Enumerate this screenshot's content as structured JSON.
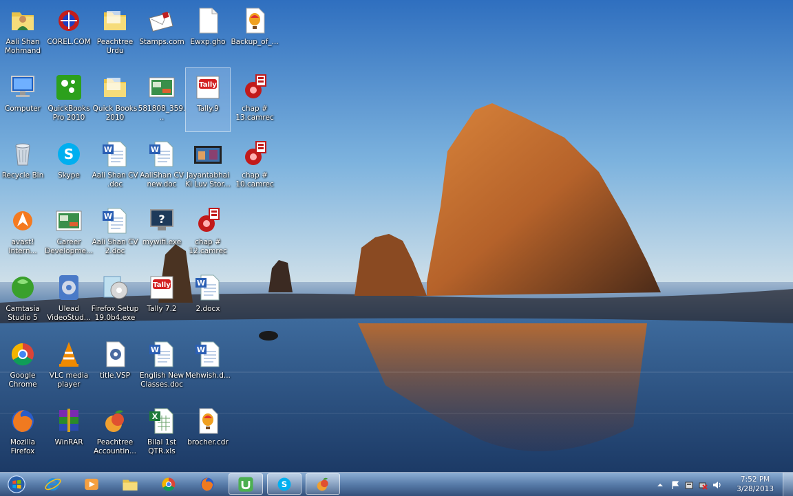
{
  "desktop": {
    "icons": [
      {
        "label": "Aali Shan Mohmand",
        "icon": "folder-user-icon"
      },
      {
        "label": "COREL.COM",
        "icon": "corel-icon"
      },
      {
        "label": "Peachtree Urdu",
        "icon": "folder-icon"
      },
      {
        "label": "Stamps.com",
        "icon": "envelope-icon"
      },
      {
        "label": "Ewxp.gho",
        "icon": "blank-file-icon"
      },
      {
        "label": "Backup_of_...",
        "icon": "balloon-file-icon"
      },
      {
        "label": "Computer",
        "icon": "computer-icon"
      },
      {
        "label": "QuickBooks Pro 2010",
        "icon": "quickbooks-icon"
      },
      {
        "label": "Quick Books 2010",
        "icon": "folder-icon"
      },
      {
        "label": "581808_359...",
        "icon": "image-file-icon"
      },
      {
        "label": "Tally.9",
        "icon": "tally-icon"
      },
      {
        "label": "chap # 13.camrec",
        "icon": "camrec-icon"
      },
      {
        "label": "Recycle Bin",
        "icon": "recycle-bin-icon"
      },
      {
        "label": "Skype",
        "icon": "skype-icon"
      },
      {
        "label": "Aali Shan CV .doc",
        "icon": "word-doc-icon"
      },
      {
        "label": "AaliShan CV new.doc",
        "icon": "word-doc-icon"
      },
      {
        "label": "Jayantabhai Ki Luv Stor...",
        "icon": "video-file-icon"
      },
      {
        "label": "chap # 10.camrec",
        "icon": "camrec-icon"
      },
      {
        "label": "avast! Intern...",
        "icon": "avast-icon"
      },
      {
        "label": "Career Developme...",
        "icon": "image-file-icon"
      },
      {
        "label": "Aali Shan CV 2.doc",
        "icon": "word-doc-icon"
      },
      {
        "label": "mywifi.exe",
        "icon": "help-monitor-icon"
      },
      {
        "label": "chap # 12.camrec",
        "icon": "camrec-icon"
      },
      {
        "label": "Camtasia Studio 5",
        "icon": "camtasia-icon"
      },
      {
        "label": "Ulead VideoStud...",
        "icon": "ulead-icon"
      },
      {
        "label": "Firefox Setup 19.0b4.exe",
        "icon": "installer-icon"
      },
      {
        "label": "Tally 7.2",
        "icon": "tally-icon"
      },
      {
        "label": "2.docx",
        "icon": "word-doc-icon"
      },
      {
        "label": "Google Chrome",
        "icon": "chrome-icon"
      },
      {
        "label": "VLC media player",
        "icon": "vlc-icon"
      },
      {
        "label": "title.VSP",
        "icon": "vsp-file-icon"
      },
      {
        "label": "English New Classes.doc",
        "icon": "word-doc-icon"
      },
      {
        "label": "Mehwish.d...",
        "icon": "word-doc-icon"
      },
      {
        "label": "Mozilla Firefox",
        "icon": "firefox-icon"
      },
      {
        "label": "WinRAR",
        "icon": "winrar-icon"
      },
      {
        "label": "Peachtree Accountin...",
        "icon": "peachtree-icon"
      },
      {
        "label": "Bilal 1st QTR.xls",
        "icon": "excel-icon"
      },
      {
        "label": "brocher.cdr",
        "icon": "balloon-file-icon"
      }
    ],
    "selected_label": "Tally.9"
  },
  "taskbar": {
    "start_icon": "windows-start-icon",
    "pinned": [
      {
        "name": "internet-explorer",
        "icon": "ie-icon"
      },
      {
        "name": "media-player",
        "icon": "media-player-icon"
      },
      {
        "name": "windows-explorer",
        "icon": "explorer-folder-icon"
      },
      {
        "name": "google-chrome",
        "icon": "chrome-icon"
      },
      {
        "name": "firefox",
        "icon": "firefox-icon"
      },
      {
        "name": "utorrent",
        "icon": "utorrent-icon"
      },
      {
        "name": "skype",
        "icon": "skype-icon"
      },
      {
        "name": "peachtree",
        "icon": "peachtree-icon"
      }
    ],
    "clock": {
      "time": "7:52 PM",
      "date": "3/28/2013"
    }
  },
  "colors": {
    "taskbar": "#4a76ab",
    "sky_top": "#3a78c2",
    "rock": "#b5622a"
  }
}
